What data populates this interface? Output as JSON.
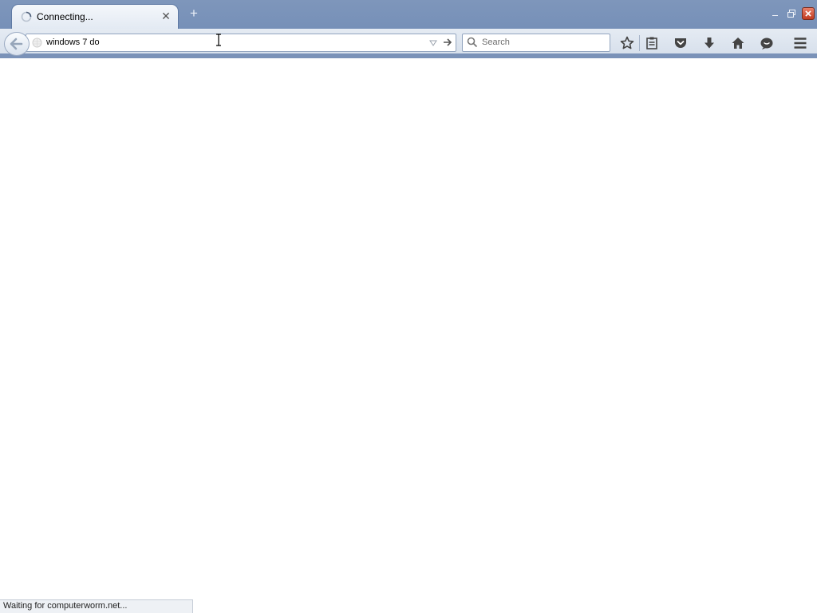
{
  "browser": {
    "tab": {
      "title": "Connecting...",
      "close_glyph": "✕",
      "loading": true
    },
    "new_tab_glyph": "+",
    "window_controls": [
      "minimize-icon",
      "restore-icon",
      "close-icon"
    ]
  },
  "navbar": {
    "back_icon": "back-arrow-icon",
    "url_input": {
      "value": "windows 7 do",
      "favicon": "globe-icon"
    },
    "search": {
      "placeholder": "Search"
    },
    "toolbar_icons": [
      "bookmark-star-icon",
      "reading-list-icon",
      "pocket-icon",
      "download-icon",
      "home-icon",
      "chat-icon",
      "hamburger-menu-icon"
    ]
  },
  "status": {
    "text": "Waiting for computerworm.net..."
  },
  "colors": {
    "titlebar": "#7a92b8",
    "toolbar": "#dde5ef",
    "window_close": "#c9452b",
    "content": "#ffffff"
  }
}
